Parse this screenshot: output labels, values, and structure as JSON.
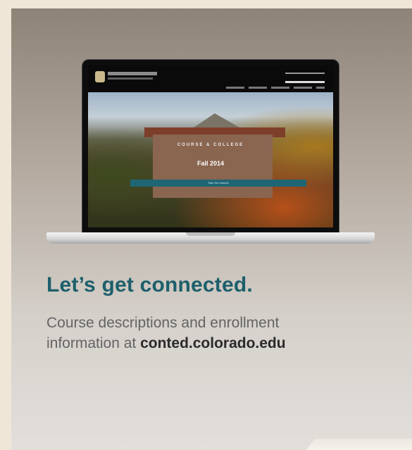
{
  "headline": "Let’s get connected.",
  "body": {
    "line1": "Course descriptions and enrollment",
    "line2_prefix": "information at ",
    "url": "conted.colorado.edu"
  },
  "laptop_screen": {
    "hero_title": "COURSE & COLLEGE",
    "hero_subtitle": "Fall 2014",
    "hero_button": "Take the classes"
  },
  "colors": {
    "headline": "#1d5f6b",
    "body": "#646464",
    "url": "#2a2a2a",
    "page_background": "#efe6d8"
  }
}
